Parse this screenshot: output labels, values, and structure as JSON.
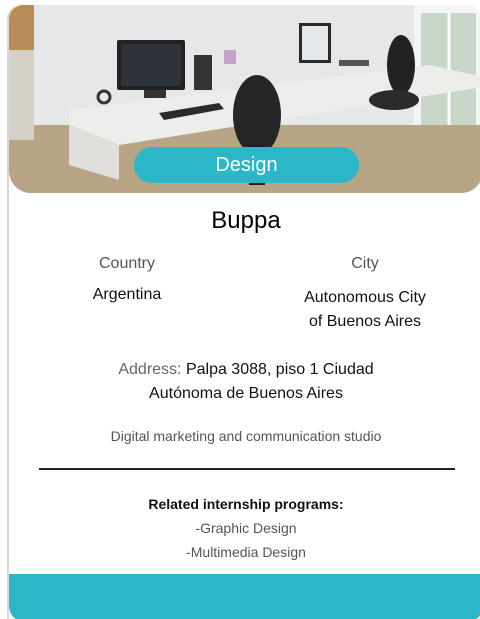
{
  "card": {
    "category": "Design",
    "company_name": "Buppa",
    "country_label": "Country",
    "country_value": "Argentina",
    "city_label": "City",
    "city_value_line1": "Autonomous City",
    "city_value_line2": "of Buenos Aires",
    "address_label": "Address:",
    "address_line1": "Palpa 3088, piso 1 Ciudad",
    "address_line2": "Autónoma de Buenos Aires",
    "description": "Digital marketing and communication studio",
    "related_title": "Related internship programs:",
    "related_programs": [
      "-Graphic Design",
      "-Multimedia Design"
    ]
  },
  "colors": {
    "accent": "#2bb7c7"
  },
  "photo": {
    "subject": "office-desk-photo"
  }
}
